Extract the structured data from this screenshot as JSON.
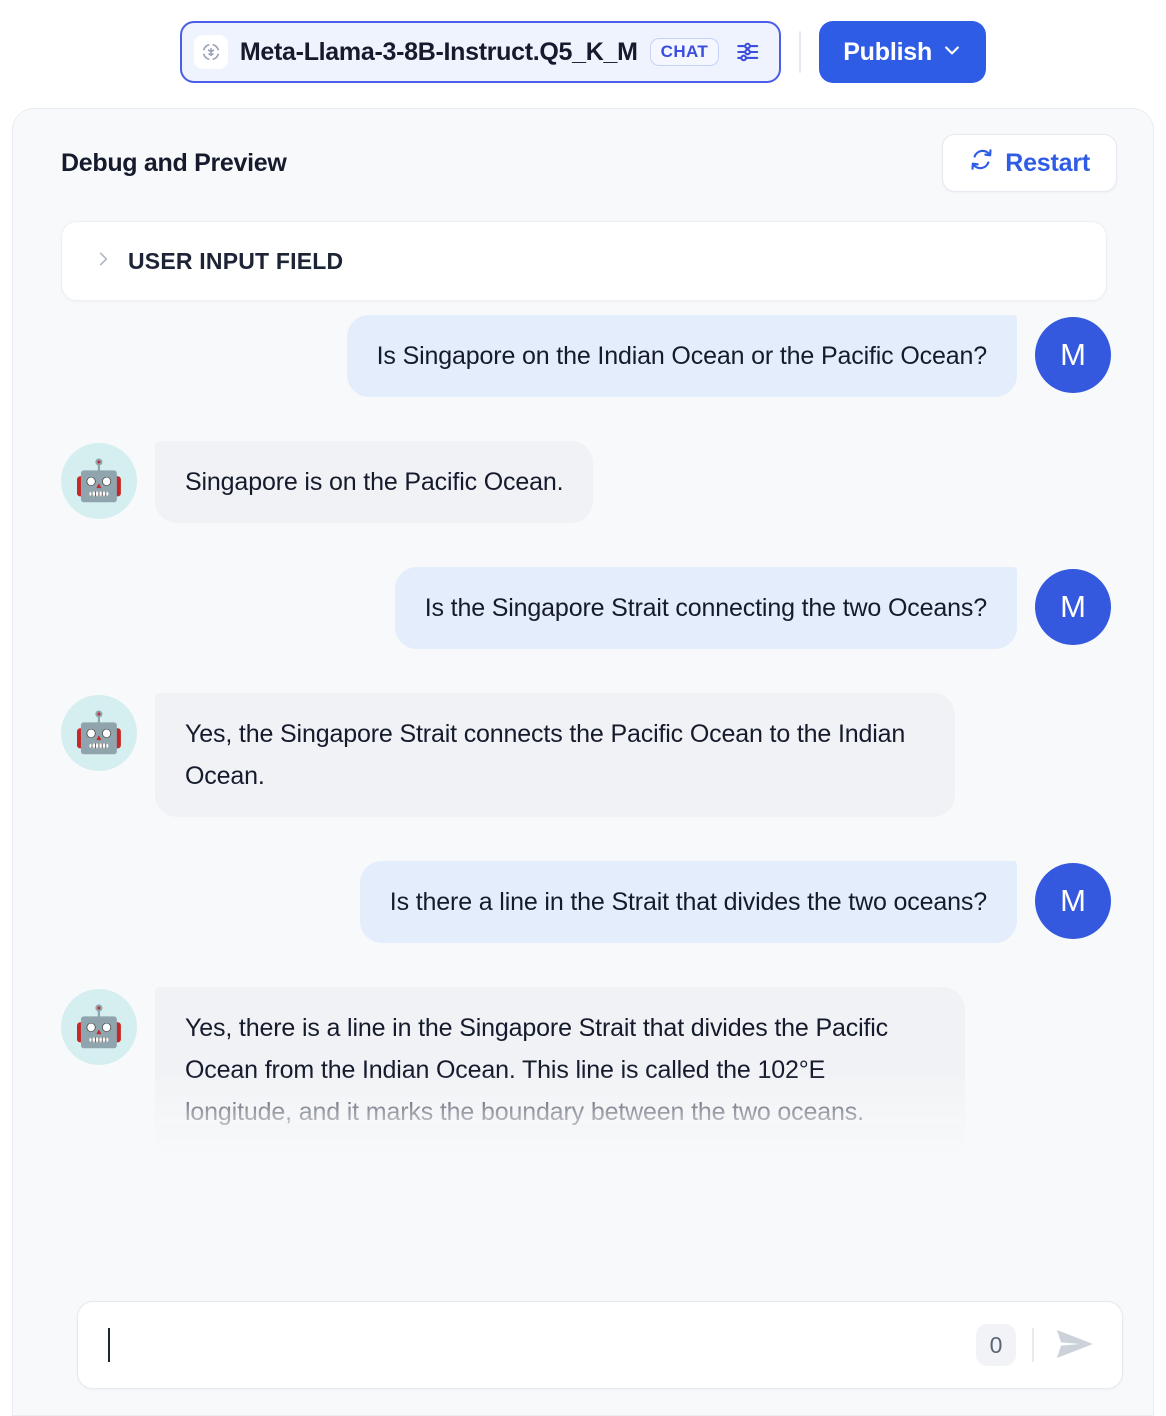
{
  "topbar": {
    "model_icon": "3d-object-icon",
    "model_name": "Meta-Llama-3-8B-Instruct.Q5_K_M",
    "mode_badge": "CHAT",
    "tune_icon": "sliders-icon",
    "publish_label": "Publish",
    "publish_chevron_icon": "chevron-down-icon",
    "accent_color": "#2f5ce4",
    "pill_border_color": "#4a5ee8"
  },
  "panel": {
    "title": "Debug and Preview",
    "restart_label": "Restart",
    "restart_icon": "refresh-icon",
    "section": {
      "chevron_icon": "chevron-right-icon",
      "label": "USER INPUT FIELD",
      "expanded": false
    }
  },
  "chat": {
    "user_avatar_initial": "M",
    "bot_avatar_emoji": "🤖",
    "user_avatar_color": "#3459de",
    "bot_avatar_color": "#d5eff1",
    "user_bubble_color": "#e4edfb",
    "bot_bubble_color": "#f1f2f5",
    "messages": [
      {
        "role": "user",
        "text": "Is Singapore on the Indian Ocean or the Pacific Ocean?"
      },
      {
        "role": "bot",
        "text": "Singapore is on the Pacific Ocean."
      },
      {
        "role": "user",
        "text": "Is the Singapore Strait connecting the two Oceans?"
      },
      {
        "role": "bot",
        "text": "Yes, the Singapore Strait connects the Pacific Ocean to the Indian Ocean."
      },
      {
        "role": "user",
        "text": "Is there a line in the Strait that divides the two oceans?"
      },
      {
        "role": "bot",
        "text": "Yes, there is a line in the Singapore Strait that divides the Pacific Ocean from the Indian Ocean. This line is called the 102°E longitude, and it marks the boundary between the two oceans.",
        "truncated": true
      }
    ]
  },
  "composer": {
    "value": "",
    "placeholder": "",
    "char_count": "0",
    "send_icon": "send-icon"
  }
}
